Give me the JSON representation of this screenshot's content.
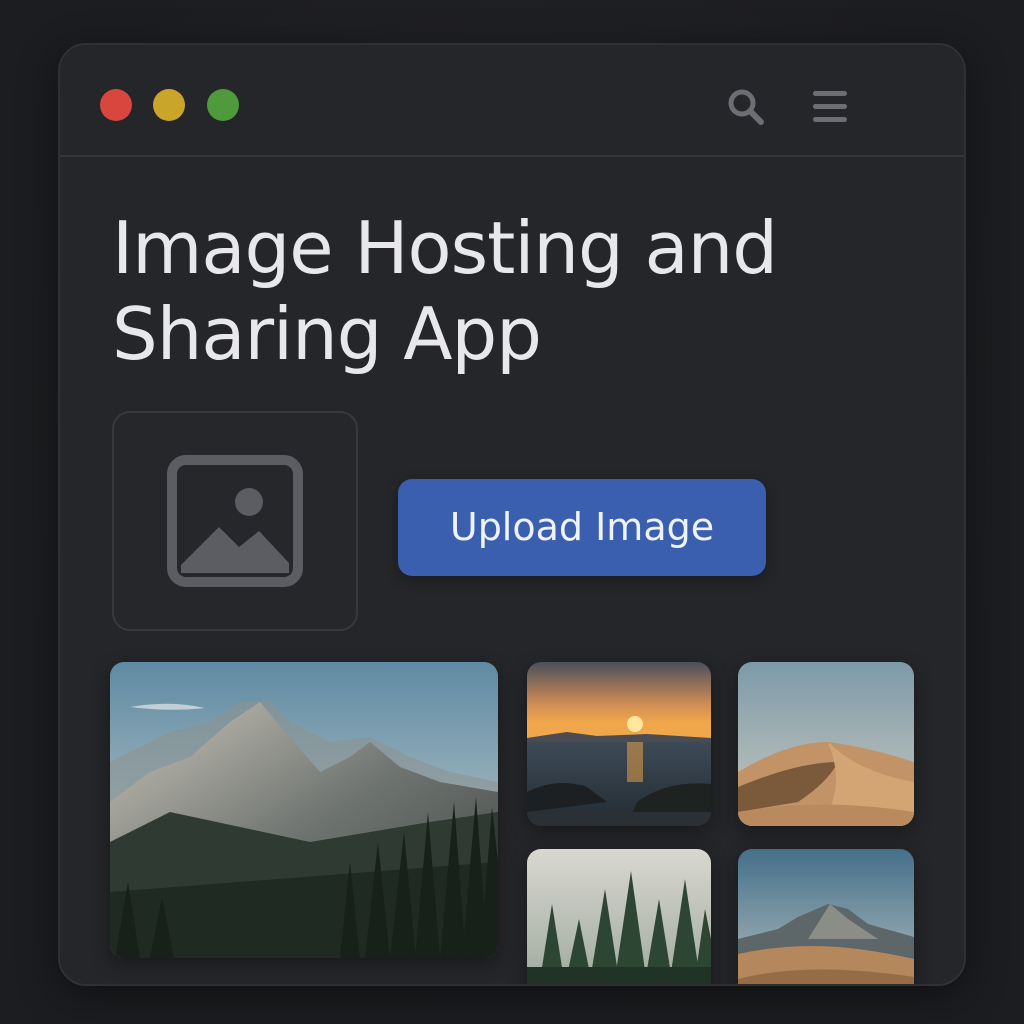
{
  "window": {
    "controls": {
      "close_color": "#d9463e",
      "minimize_color": "#c9a62a",
      "maximize_color": "#4f9a3a"
    },
    "toolbar_icons": [
      "search-icon",
      "hamburger-menu-icon"
    ]
  },
  "header": {
    "title_line1": "Image Hosting and",
    "title_line2": "Sharing App"
  },
  "upload": {
    "placeholder_icon": "image-placeholder-icon",
    "button_label": "Upload Image",
    "accent_color": "#3a5faf"
  },
  "gallery": {
    "images": [
      {
        "subject": "mountain-forest"
      },
      {
        "subject": "ocean-sunset"
      },
      {
        "subject": "sand-dunes"
      },
      {
        "subject": "misty-pine-forest"
      },
      {
        "subject": "desert-mountain"
      }
    ]
  }
}
